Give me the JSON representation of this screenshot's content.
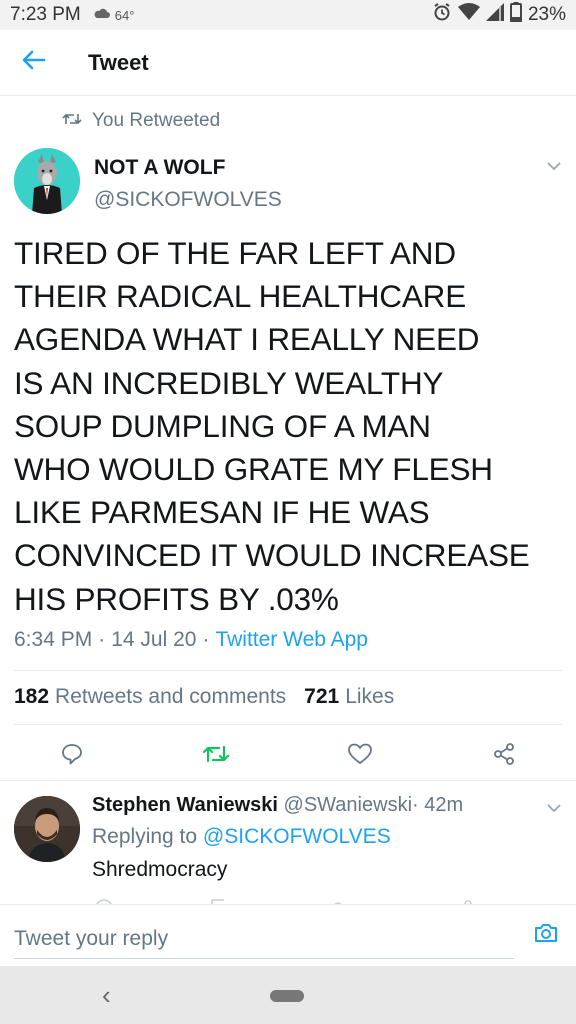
{
  "status_bar": {
    "time": "7:23 PM",
    "temperature": "64°",
    "battery": "23%",
    "icons": [
      "weather-icon",
      "alarm-icon",
      "wifi-icon",
      "signal-icon",
      "battery-icon"
    ]
  },
  "header": {
    "title": "Tweet",
    "back_icon": "back-arrow-icon"
  },
  "retweet": {
    "label": "You Retweeted"
  },
  "tweet": {
    "author_name": "NOT A WOLF",
    "author_handle": "@SICKOFWOLVES",
    "lines": [
      "TIRED OF THE FAR LEFT AND",
      "THEIR RADICAL HEALTHCARE",
      "AGENDA WHAT I REALLY NEED",
      "IS AN INCREDIBLY WEALTHY",
      "SOUP DUMPLING OF A MAN",
      "WHO WOULD GRATE MY FLESH",
      "LIKE PARMESAN IF HE WAS",
      "CONVINCED IT WOULD INCREASE",
      "HIS PROFITS BY .03%"
    ],
    "time": "6:34 PM",
    "date": "14 Jul 20",
    "source": "Twitter Web App",
    "sep": "·",
    "retweets_count": "182",
    "retweets_label": "Retweets and comments",
    "likes_count": "721",
    "likes_label": "Likes"
  },
  "colors": {
    "accent": "#1da1f2",
    "retweet_green": "#17bf63",
    "muted": "#657786",
    "avatar_teal": "#3ad1c9"
  },
  "reply": {
    "name": "Stephen Waniewski",
    "handle": "@SWaniewski",
    "sep": "·",
    "age": "42m",
    "replying_label": "Replying to",
    "replying_mention": "@SICKOFWOLVES",
    "text": "Shredmocracy"
  },
  "composer": {
    "placeholder": "Tweet your reply"
  }
}
